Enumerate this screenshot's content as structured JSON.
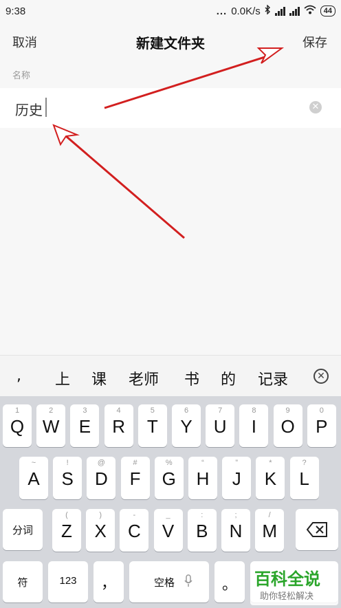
{
  "status": {
    "time": "9:38",
    "dots": "...",
    "speed": "0.0K/s",
    "battery": "44"
  },
  "header": {
    "cancel": "取消",
    "title": "新建文件夹",
    "save": "保存"
  },
  "field": {
    "label": "名称",
    "value": "历史"
  },
  "suggestions": [
    ",",
    "上",
    "课",
    "老师",
    "书",
    "的",
    "记录"
  ],
  "keyboard": {
    "row1": [
      {
        "hint": "1",
        "key": "Q"
      },
      {
        "hint": "2",
        "key": "W"
      },
      {
        "hint": "3",
        "key": "E"
      },
      {
        "hint": "4",
        "key": "R"
      },
      {
        "hint": "5",
        "key": "T"
      },
      {
        "hint": "6",
        "key": "Y"
      },
      {
        "hint": "7",
        "key": "U"
      },
      {
        "hint": "8",
        "key": "I"
      },
      {
        "hint": "9",
        "key": "O"
      },
      {
        "hint": "0",
        "key": "P"
      }
    ],
    "row2": [
      {
        "hint": "~",
        "key": "A"
      },
      {
        "hint": "!",
        "key": "S"
      },
      {
        "hint": "@",
        "key": "D"
      },
      {
        "hint": "#",
        "key": "F"
      },
      {
        "hint": "%",
        "key": "G"
      },
      {
        "hint": "“",
        "key": "H"
      },
      {
        "hint": "”",
        "key": "J"
      },
      {
        "hint": "*",
        "key": "K"
      },
      {
        "hint": "?",
        "key": "L"
      }
    ],
    "row3": [
      {
        "hint": "(",
        "key": "Z"
      },
      {
        "hint": ")",
        "key": "X"
      },
      {
        "hint": "-",
        "key": "C"
      },
      {
        "hint": "_",
        "key": "V"
      },
      {
        "hint": ":",
        "key": "B"
      },
      {
        "hint": ";",
        "key": "N"
      },
      {
        "hint": "/",
        "key": "M"
      }
    ],
    "segment_label": "分词",
    "symbol_label": "符",
    "number_label": "123",
    "comma_label": "，",
    "space_label": "空格",
    "period_label": "。"
  },
  "watermark": {
    "title": "百科全说",
    "subtitle": "助你轻松解决"
  },
  "colors": {
    "arrow": "#d21f1f",
    "watermark_green": "#2aa52a"
  }
}
